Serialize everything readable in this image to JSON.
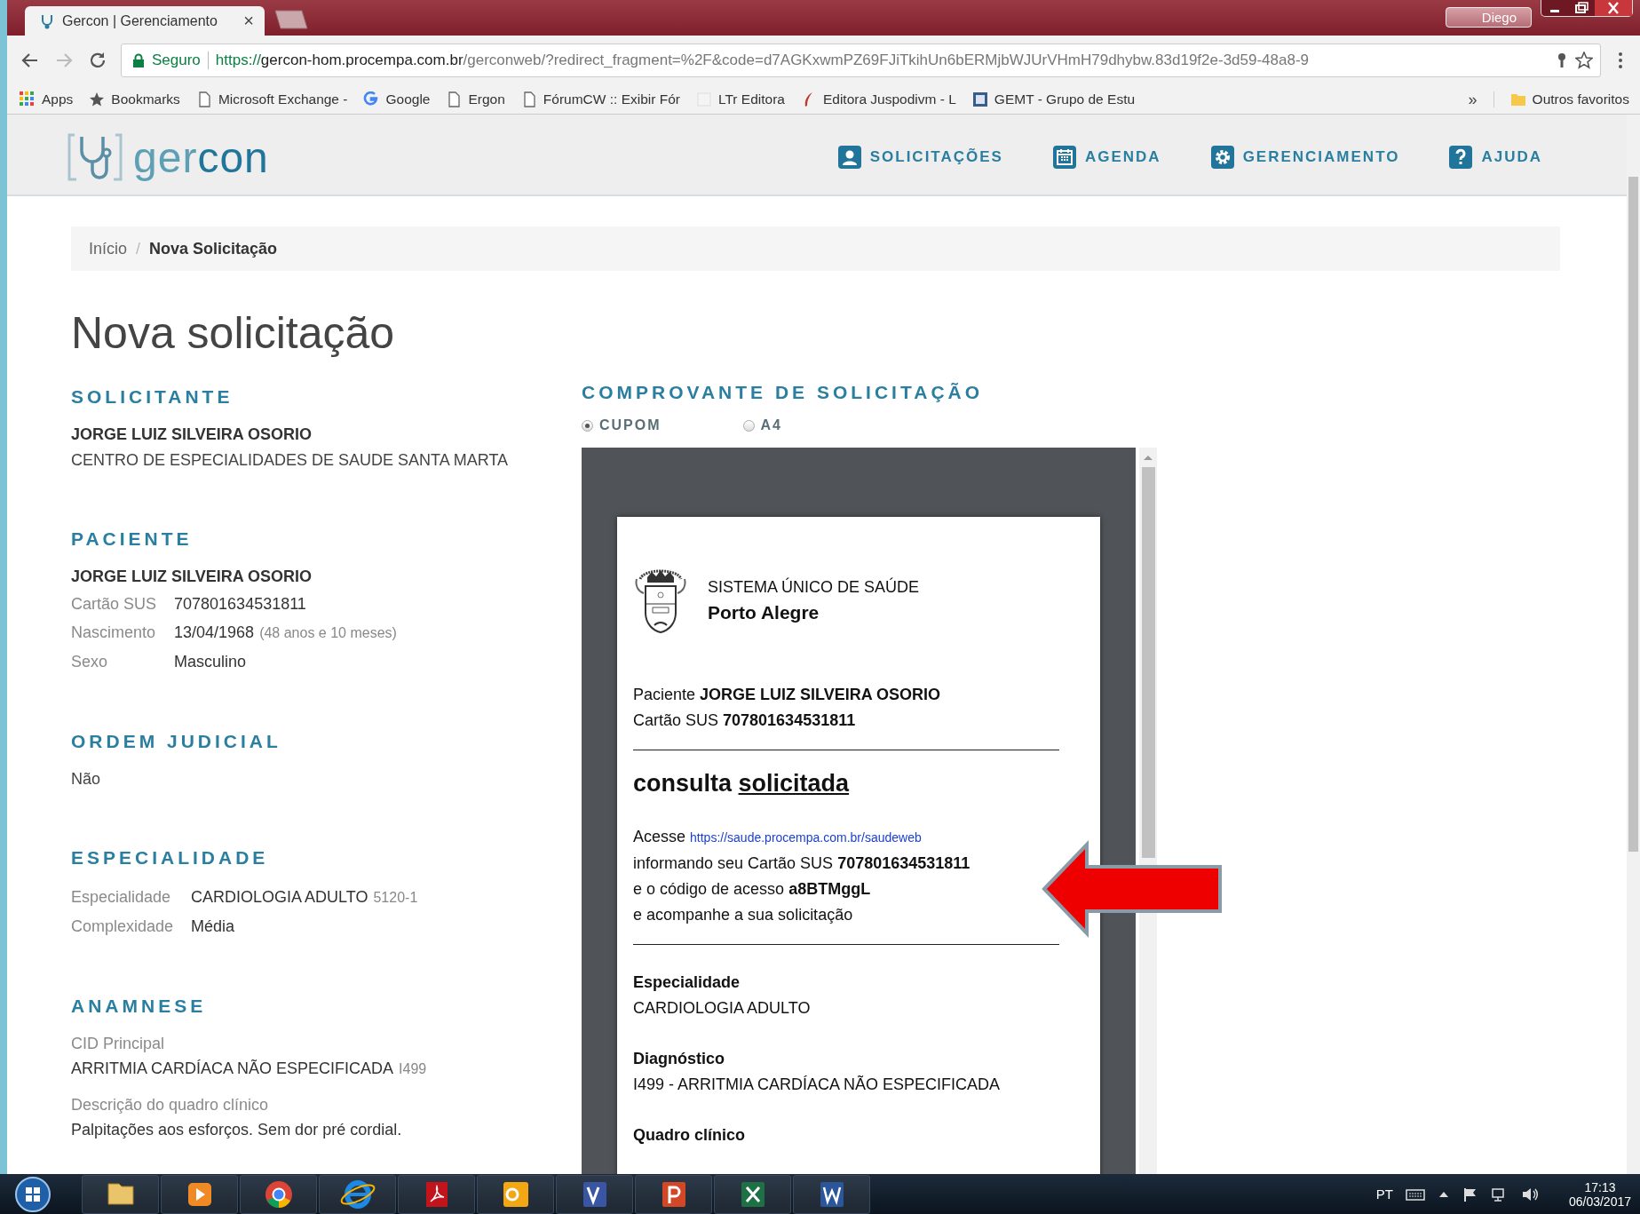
{
  "browser": {
    "tab": {
      "title": "Gercon | Gerenciamento",
      "close": "×"
    },
    "user": "Diego",
    "address_bar": {
      "secure_label": "Seguro",
      "url_scheme": "https://",
      "url_host": "gercon-hom.procempa.com.br",
      "url_path": "/gerconweb/?redirect_fragment=%2F&code=d7AGKxwmPZ69FJiTkihUn6bERMjbWJUrVHmH79dhybw.83d19f2e-3d59-48a8-9"
    },
    "bookmarks": [
      {
        "kind": "apps",
        "label": "Apps"
      },
      {
        "kind": "star",
        "label": "Bookmarks"
      },
      {
        "kind": "page",
        "label": "Microsoft Exchange -"
      },
      {
        "kind": "google",
        "label": "Google"
      },
      {
        "kind": "page",
        "label": "Ergon"
      },
      {
        "kind": "page",
        "label": "FórumCW :: Exibir Fór"
      },
      {
        "kind": "blank",
        "label": "LTr Editora"
      },
      {
        "kind": "feather",
        "label": "Editora Juspodivm - L"
      },
      {
        "kind": "site",
        "label": "GEMT - Grupo de Estu"
      }
    ],
    "bookmarks_more": "»",
    "other_bookmarks": "Outros favoritos"
  },
  "app": {
    "logo": "ger**con**",
    "nav": [
      {
        "kind": "user",
        "label": "SOLICITAÇÕES"
      },
      {
        "kind": "calendar",
        "label": "AGENDA"
      },
      {
        "kind": "gear",
        "label": "GERENCIAMENTO"
      },
      {
        "kind": "help",
        "label": "AJUDA"
      }
    ]
  },
  "breadcrumb": {
    "separator": "/",
    "items": [
      {
        "label": "Início",
        "current": false
      },
      {
        "label": "Nova Solicitação",
        "current": true
      }
    ]
  },
  "page_title": "Nova solicitação",
  "sections": [
    {
      "title": "SOLICITANTE",
      "lines": [
        {
          "text": "JORGE LUIZ SILVEIRA OSORIO",
          "strong": true
        },
        {
          "text": "CENTRO DE ESPECIALIDADES DE SAUDE SANTA MARTA",
          "strong": false
        }
      ]
    },
    {
      "title": "PACIENTE",
      "lines": [
        {
          "text": "JORGE LUIZ SILVEIRA OSORIO",
          "strong": true
        }
      ],
      "fields": [
        {
          "label": "Cartão SUS",
          "value": "707801634531811"
        },
        {
          "label": "Nascimento",
          "value": "13/04/1968",
          "note": "(48 anos e 10 meses)"
        },
        {
          "label": "Sexo",
          "value": "Masculino"
        }
      ]
    },
    {
      "title": "ORDEM JUDICIAL",
      "lines": [
        {
          "text": "Não",
          "strong": false
        }
      ]
    },
    {
      "title": "ESPECIALIDADE",
      "fields": [
        {
          "label": "Especialidade",
          "value": "CARDIOLOGIA ADULTO",
          "note": "5120-1"
        },
        {
          "label": "Complexidade",
          "value": "Média"
        }
      ]
    },
    {
      "title": "ANAMNESE",
      "blocks": [
        {
          "label": "CID Principal",
          "value": "ARRITMIA CARDÍACA NÃO ESPECIFICADA",
          "note": "I499"
        },
        {
          "label": "Descrição do quadro clínico",
          "value": "Palpitações aos esforços. Sem dor pré cordial."
        }
      ]
    }
  ],
  "receipt": {
    "title": "COMPROVANTE DE SOLICITAÇÃO",
    "formats": [
      {
        "label": "CUPOM",
        "selected": true
      },
      {
        "label": "A4",
        "selected": false
      }
    ],
    "header": {
      "system": "SISTEMA ÚNICO DE SAÚDE",
      "city": "Porto Alegre"
    },
    "patient_lines": [
      "Paciente **JORGE LUIZ SILVEIRA OSORIO**",
      "Cartão SUS **707801634531811**"
    ],
    "heading": [
      {
        "text": "consulta",
        "underlined": false
      },
      {
        "text": "solicitada",
        "underlined": true
      }
    ],
    "access": {
      "prefix": "Acesse",
      "link": "https://saude.procempa.com.br/saudeweb",
      "lines": [
        "informando seu Cartão SUS **707801634531811**",
        "e o código de acesso **a8BTMggL**",
        "e acompanhe a sua solicitação"
      ]
    },
    "details": [
      {
        "label": "Especialidade",
        "value": "CARDIOLOGIA ADULTO"
      },
      {
        "label": "Diagnóstico",
        "value": "I499 - ARRITMIA CARDÍACA NÃO ESPECIFICADA"
      },
      {
        "label": "Quadro clínico"
      }
    ]
  },
  "taskbar": {
    "apps": [
      {
        "kind": "folder"
      },
      {
        "kind": "media"
      },
      {
        "kind": "chrome"
      },
      {
        "kind": "ie"
      },
      {
        "kind": "pdf"
      },
      {
        "kind": "outlook"
      },
      {
        "kind": "visio"
      },
      {
        "kind": "powerpoint"
      },
      {
        "kind": "excel"
      },
      {
        "kind": "word"
      }
    ],
    "language": "PT",
    "time": "17:13",
    "date": "06/03/2017"
  }
}
